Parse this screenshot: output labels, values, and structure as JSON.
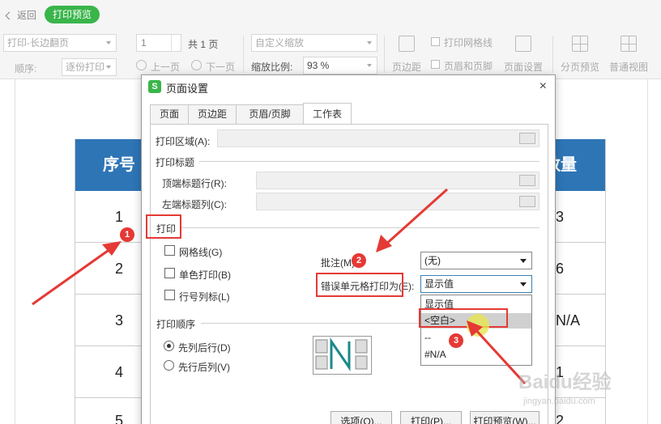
{
  "topbar": {
    "back_label": "返回",
    "preview_label": "打印预览"
  },
  "toolbar": {
    "duplex_select": "打印-长边翻页",
    "order_label": "顺序:",
    "order_select": "逐份打印",
    "page_value": "1",
    "page_total": "共 1 页",
    "prev_page": "上一页",
    "next_page": "下一页",
    "zoom_select": "自定义缩放",
    "zoom_ratio_label": "缩放比例:",
    "zoom_ratio_value": "93 %",
    "margin_label": "页边距",
    "print_gridlines": "打印网格线",
    "header_footer": "页眉和页脚",
    "page_setup": "页面设置",
    "page_break_preview": "分页预览",
    "normal_view": "普通视图"
  },
  "sheet": {
    "headers": [
      "序号",
      "数量"
    ],
    "rows": [
      {
        "no": "1",
        "qty": "3"
      },
      {
        "no": "2",
        "qty": "6"
      },
      {
        "no": "3",
        "qty": "N/A"
      },
      {
        "no": "4",
        "qty": "1"
      },
      {
        "no": "5",
        "qty": "2"
      }
    ]
  },
  "dialog": {
    "title": "页面设置",
    "close": "×",
    "tabs": [
      "页面",
      "页边距",
      "页眉/页脚",
      "工作表"
    ],
    "active_tab": "工作表",
    "print_area_label": "打印区域(A):",
    "print_titles_group": "打印标题",
    "top_rows_label": "顶端标题行(R):",
    "left_cols_label": "左端标题列(C):",
    "print_group": "打印",
    "gridlines_cb": "网格线(G)",
    "mono_cb": "单色打印(B)",
    "rowcol_cb": "行号列标(L)",
    "comments_label": "批注(M):",
    "comments_value": "(无)",
    "errors_label": "错误单元格打印为(E):",
    "errors_value": "显示值",
    "errors_options": [
      "显示值",
      "<空白>",
      "--",
      "#N/A"
    ],
    "errors_highlight": "<空白>",
    "order_group": "打印顺序",
    "down_then_over": "先列后行(D)",
    "over_then_down": "先行后列(V)",
    "btn_options": "选项(O)...",
    "btn_print": "打印(P)...",
    "btn_preview": "打印预览(W)..."
  },
  "annotations": {
    "badges": [
      "1",
      "2",
      "3"
    ],
    "color": "#e53935"
  },
  "watermark": {
    "brand": "Baidu经验",
    "url": "jingyan.baidu.com"
  }
}
